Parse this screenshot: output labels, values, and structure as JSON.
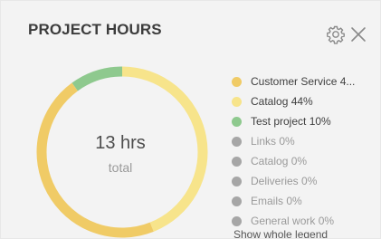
{
  "widget": {
    "title": "PROJECT HOURS",
    "settings_icon": "gear-icon",
    "close_icon": "close-icon"
  },
  "donut": {
    "value": "13 hrs",
    "label": "total"
  },
  "legend": {
    "items": [
      {
        "label": "Customer Service 4...",
        "color": "#f0cb66",
        "active": true
      },
      {
        "label": "Catalog 44%",
        "color": "#f7e48b",
        "active": true
      },
      {
        "label": "Test project 10%",
        "color": "#8ec98e",
        "active": true
      },
      {
        "label": "Links 0%",
        "color": "#a6a6a6",
        "active": false
      },
      {
        "label": "Catalog 0%",
        "color": "#a6a6a6",
        "active": false
      },
      {
        "label": "Deliveries 0%",
        "color": "#a6a6a6",
        "active": false
      },
      {
        "label": "Emails 0%",
        "color": "#a6a6a6",
        "active": false
      },
      {
        "label": "General work 0%",
        "color": "#a6a6a6",
        "active": false
      }
    ],
    "show_all_label": "Show whole legend"
  },
  "chart_data": {
    "type": "pie",
    "categories": [
      "Customer Service",
      "Catalog",
      "Test project",
      "Links",
      "Catalog",
      "Deliveries",
      "Emails",
      "General work"
    ],
    "values": [
      46,
      44,
      10,
      0,
      0,
      0,
      0,
      0
    ],
    "colors": [
      "#f0cb66",
      "#f7e48b",
      "#8ec98e",
      "#a6a6a6",
      "#a6a6a6",
      "#a6a6a6",
      "#a6a6a6",
      "#a6a6a6"
    ],
    "title": "PROJECT HOURS",
    "center_text": "13 hrs"
  }
}
